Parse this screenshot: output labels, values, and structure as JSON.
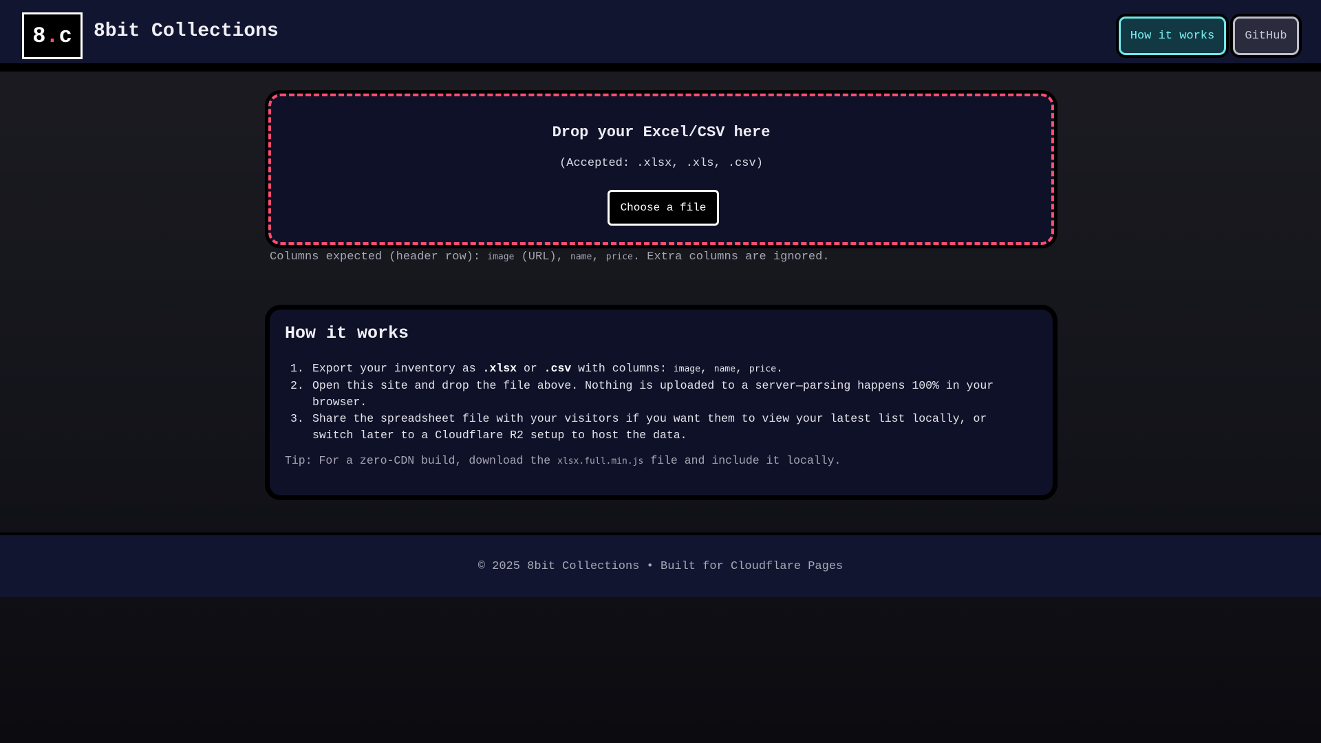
{
  "header": {
    "logo_main": "8",
    "logo_dot": ".",
    "logo_tail": "c",
    "brand": "8bit Collections",
    "nav": {
      "how_label": "How it works",
      "github_label": "GitHub"
    }
  },
  "dropzone": {
    "title": "Drop your Excel/CSV here",
    "accepted": "(Accepted: .xlsx, .xls, .csv)",
    "button_label": "Choose a file"
  },
  "columns_note": {
    "prefix": "Columns expected (header row): ",
    "col1": "image",
    "mid1": " (URL), ",
    "col2": "name",
    "sep": ", ",
    "col3": "price",
    "suffix": ". Extra columns are ignored."
  },
  "how": {
    "title": "How it works",
    "steps": [
      {
        "num": "1.",
        "t1": "Export your inventory as ",
        "b1": ".xlsx",
        "t2": " or ",
        "b2": ".csv",
        "t3": " with columns: ",
        "c1": "image",
        "s1": ", ",
        "c2": "name",
        "s2": ", ",
        "c3": "price",
        "t4": "."
      },
      {
        "num": "2.",
        "text": "Open this site and drop the file above. Nothing is uploaded to a server—parsing happens 100% in your browser."
      },
      {
        "num": "3.",
        "text": "Share the spreadsheet file with your visitors if you want them to view your latest list locally, or switch later to a Cloudflare R2 setup to host the data."
      }
    ],
    "tip": {
      "prefix": "Tip: For a zero-CDN build, download the ",
      "file": "xlsx.full.min.js",
      "suffix": " file and include it locally."
    }
  },
  "footer": {
    "text": "© 2025 8bit Collections • Built for Cloudflare Pages"
  },
  "colors": {
    "accent_pink": "#ff4d6d",
    "accent_cyan": "#6fe7ea",
    "panel": "#0f1128",
    "bar": "#121530"
  }
}
